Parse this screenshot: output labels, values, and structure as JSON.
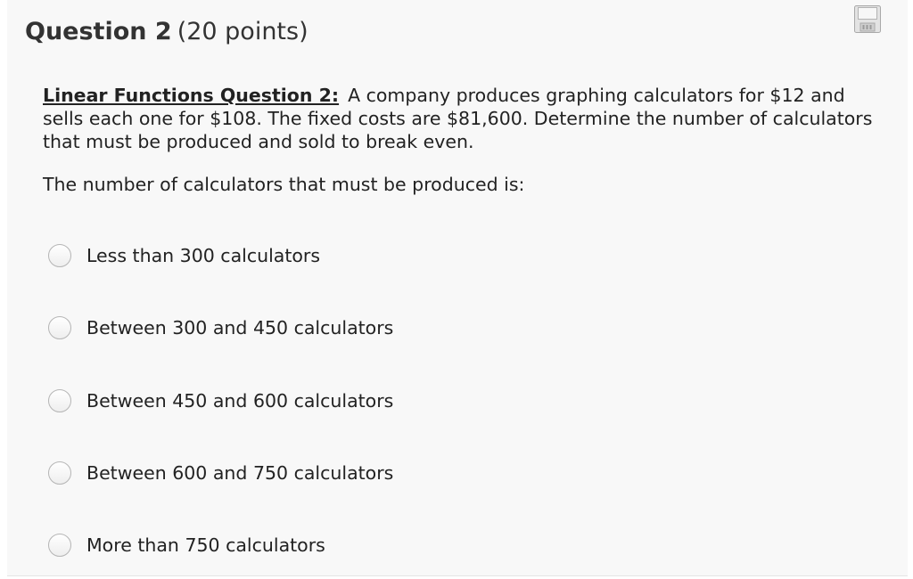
{
  "header": {
    "title": "Question 2",
    "points": "(20 points)"
  },
  "toolbar": {
    "save_icon": "floppy-disk-save-icon"
  },
  "question": {
    "label": "Linear Functions Question 2:",
    "text": "A company produces graphing calculators for $12 and sells each one for $108.  The fixed costs are $81,600.  Determine the number of calculators that must be produced and sold to break even."
  },
  "prompt": "The number of calculators that must be produced is:",
  "options": [
    {
      "label": "Less than 300 calculators",
      "selected": false
    },
    {
      "label": "Between 300 and 450 calculators",
      "selected": false
    },
    {
      "label": "Between 450 and 600 calculators",
      "selected": false
    },
    {
      "label": "Between 600 and 750 calculators",
      "selected": false
    },
    {
      "label": "More than 750 calculators",
      "selected": false
    }
  ]
}
